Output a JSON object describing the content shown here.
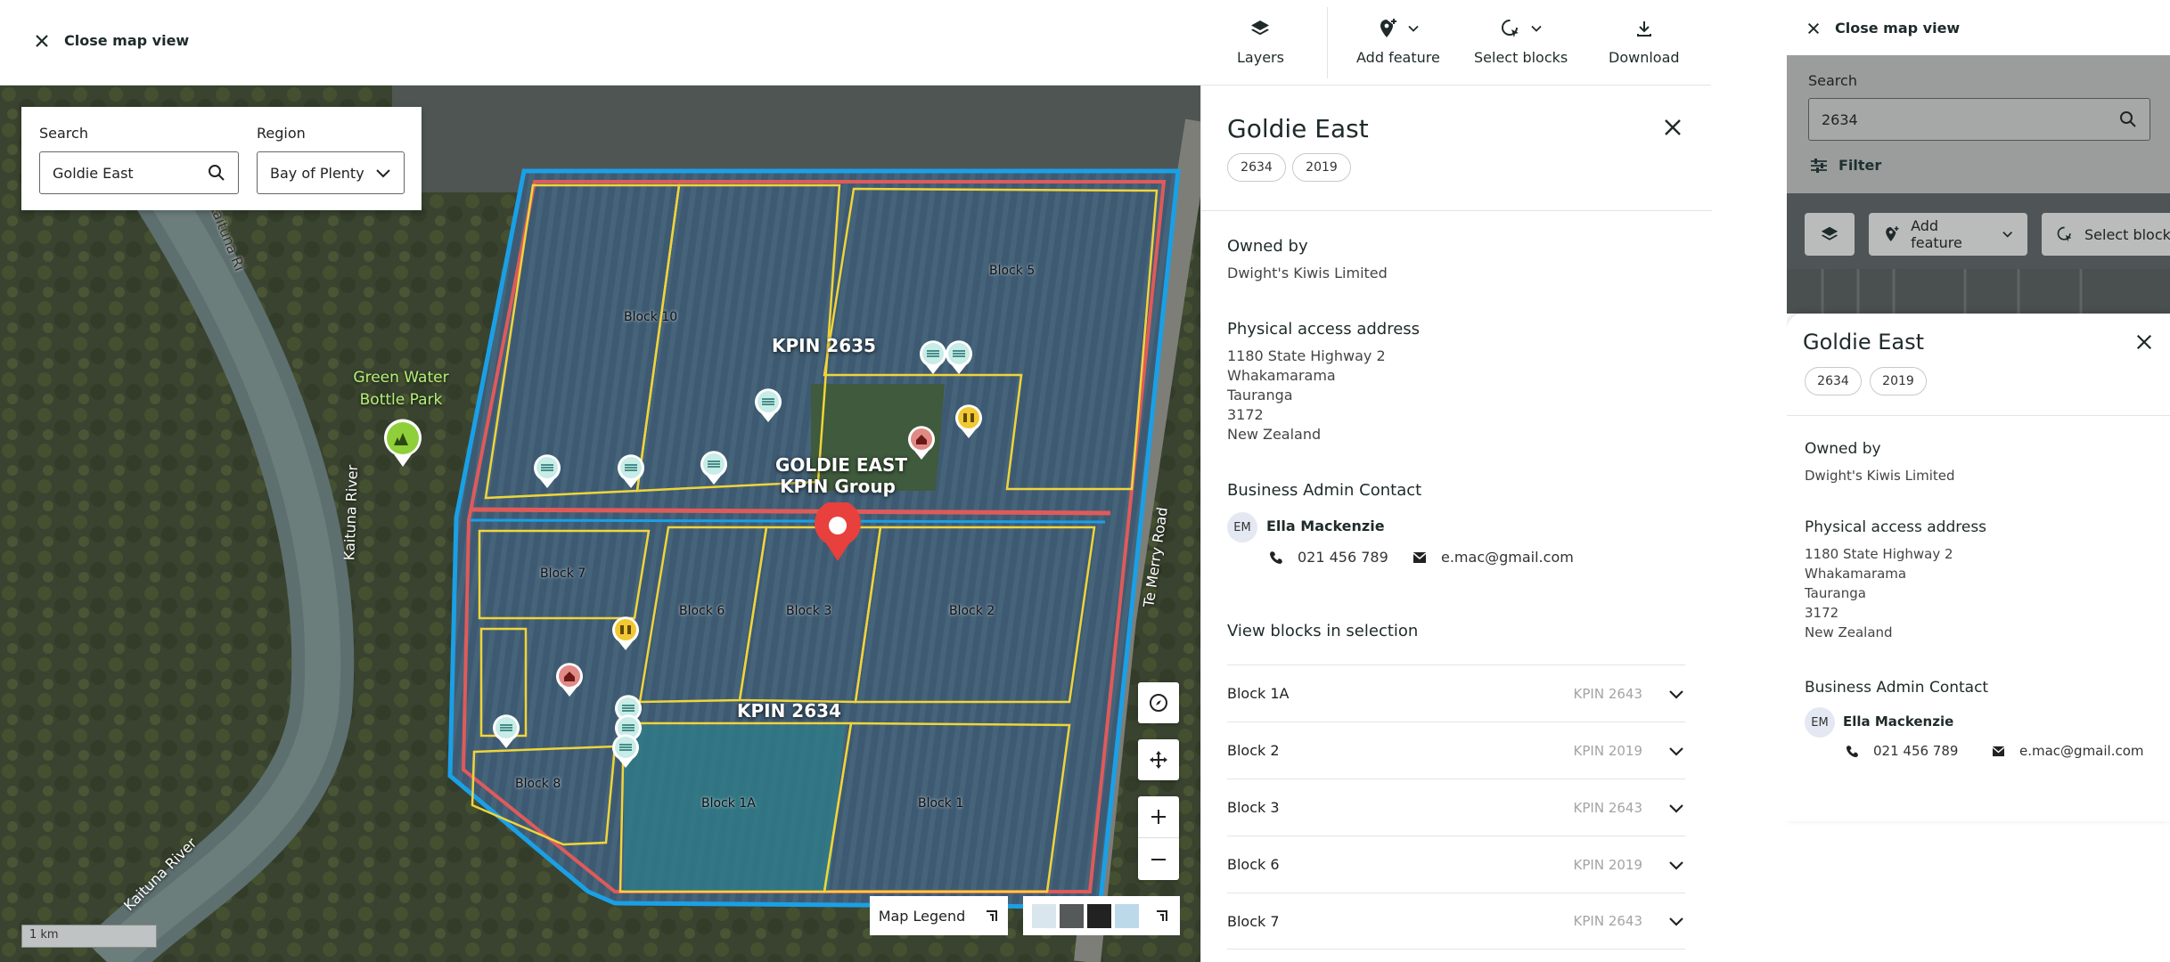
{
  "topbar": {
    "close_label": "Close map view",
    "tools": [
      {
        "label": "Layers",
        "icon": "layers-icon"
      },
      {
        "label": "Add feature",
        "icon": "add-location-icon"
      },
      {
        "label": "Select blocks",
        "icon": "lasso-select-icon"
      },
      {
        "label": "Download",
        "icon": "download-icon"
      }
    ]
  },
  "search": {
    "search_label": "Search",
    "search_value": "Goldie East",
    "region_label": "Region",
    "region_value": "Bay of Plenty"
  },
  "map": {
    "park_label": "Green Water\nBottle Park",
    "river_labels": [
      "Kaituna River",
      "Kaituna River",
      "Kaituna Ri"
    ],
    "road_label": "Te Merry Road",
    "orchard_title": "GOLDIE EAST",
    "orchard_subtitle": "KPIN Group",
    "kpin_labels": [
      "KPIN 2635",
      "KPIN 2634"
    ],
    "blocks": [
      "Block 10",
      "Block 5",
      "Block 7",
      "Block 6",
      "Block 3",
      "Block 2",
      "Block 8",
      "Block 1A",
      "Block 1"
    ],
    "legend_label": "Map Legend",
    "scale_label": "1 km",
    "colors": {
      "outer_boundary": "#1aa0e6",
      "kpin_boundary": "#e05a5a",
      "block_boundary": "#f0d43a",
      "selected_pin": "#e8403c"
    }
  },
  "detail": {
    "title": "Goldie East",
    "chips": [
      "2634",
      "2019"
    ],
    "owned_by_label": "Owned by",
    "owner": "Dwight's Kiwis Limited",
    "address_label": "Physical access address",
    "address_lines": [
      "1180 State Highway 2",
      "Whakamarama",
      "Tauranga",
      "3172",
      "New Zealand"
    ],
    "admin_label": "Business Admin Contact",
    "contact": {
      "initials": "EM",
      "name": "Ella Mackenzie",
      "phone": "021 456 789",
      "email": "e.mac@gmail.com"
    },
    "blocks_label": "View blocks in selection",
    "block_rows": [
      {
        "name": "Block 1A",
        "kpin": "KPIN 2643"
      },
      {
        "name": "Block 2",
        "kpin": "KPIN 2019"
      },
      {
        "name": "Block 3",
        "kpin": "KPIN 2643"
      },
      {
        "name": "Block 6",
        "kpin": "KPIN 2019"
      },
      {
        "name": "Block 7",
        "kpin": "KPIN 2643"
      }
    ]
  },
  "mobile": {
    "close_label": "Close map view",
    "search_label": "Search",
    "search_value": "2634",
    "filter_label": "Filter",
    "add_feature_label": "Add feature",
    "select_blocks_label": "Select blocks",
    "title": "Goldie East",
    "chips": [
      "2634",
      "2019"
    ],
    "owned_by_label": "Owned by",
    "owner": "Dwight's Kiwis Limited",
    "address_label": "Physical access address",
    "address_lines": [
      "1180 State Highway 2",
      "Whakamarama",
      "Tauranga",
      "3172",
      "New Zealand"
    ],
    "admin_label": "Business Admin Contact",
    "contact": {
      "initials": "EM",
      "name": "Ella Mackenzie",
      "phone": "021 456 789",
      "email": "e.mac@gmail.com"
    }
  }
}
